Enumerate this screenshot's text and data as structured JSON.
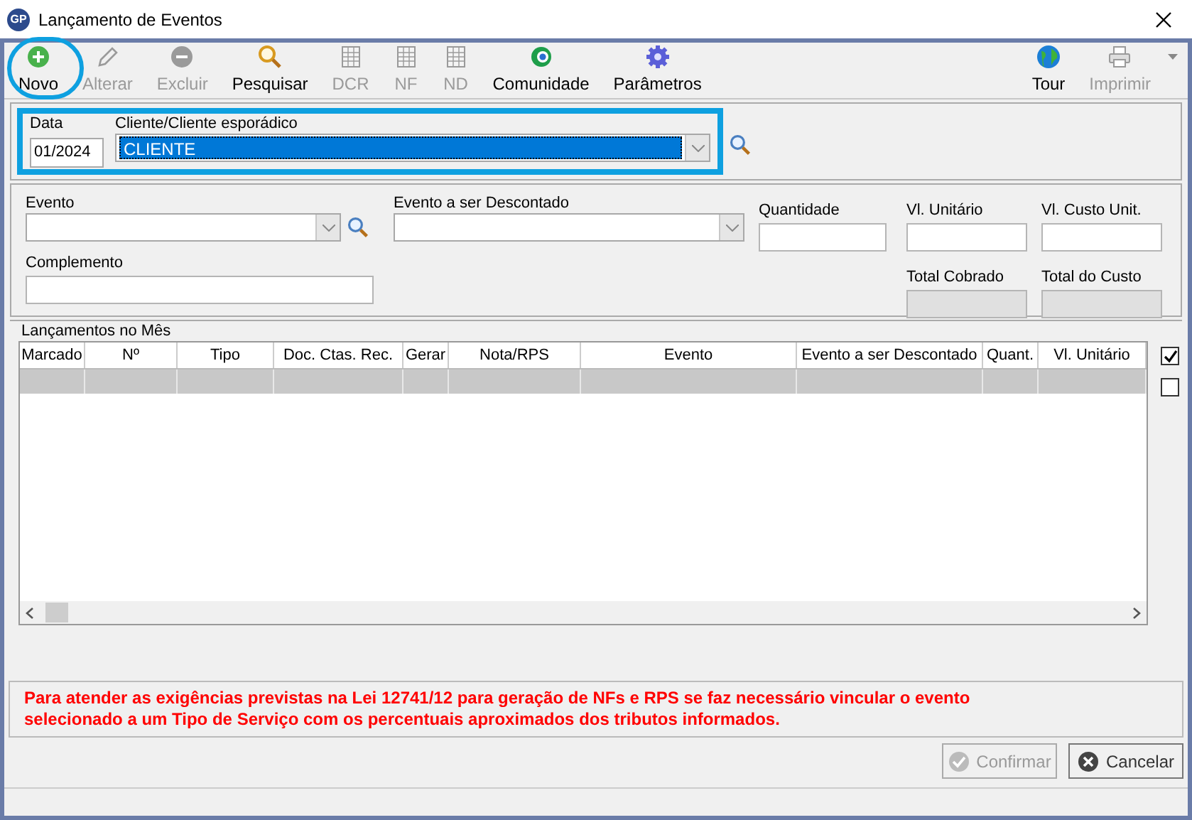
{
  "window": {
    "title": "Lançamento de Eventos",
    "logo": "GP"
  },
  "toolbar": [
    {
      "label": "Novo",
      "kind": "add",
      "disabled": false
    },
    {
      "label": "Alterar",
      "kind": "edit",
      "disabled": true
    },
    {
      "label": "Excluir",
      "kind": "delete",
      "disabled": true
    },
    {
      "label": "Pesquisar",
      "kind": "search",
      "disabled": false
    },
    {
      "label": "DCR",
      "kind": "grid",
      "disabled": true
    },
    {
      "label": "NF",
      "kind": "grid",
      "disabled": true
    },
    {
      "label": "ND",
      "kind": "grid",
      "disabled": true
    },
    {
      "label": "Comunidade",
      "kind": "community",
      "disabled": false
    },
    {
      "label": "Parâmetros",
      "kind": "gear",
      "disabled": false
    }
  ],
  "toolbar_right": [
    {
      "label": "Tour",
      "kind": "globe",
      "disabled": false
    },
    {
      "label": "Imprimir",
      "kind": "printer",
      "disabled": true
    }
  ],
  "header": {
    "date_label": "Data",
    "date_value": "01/2024",
    "client_label": "Cliente/Cliente esporádico",
    "client_value": "CLIENTE"
  },
  "form": {
    "evento_label": "Evento",
    "descontado_label": "Evento a ser Descontado",
    "quantidade_label": "Quantidade",
    "vl_unitario_label": "Vl. Unitário",
    "vl_custo_label": "Vl. Custo Unit.",
    "complemento_label": "Complemento",
    "total_cobrado_label": "Total Cobrado",
    "total_custo_label": "Total do Custo"
  },
  "table": {
    "title": "Lançamentos no Mês",
    "columns": [
      "Marcado",
      "Nº",
      "Tipo",
      "Doc. Ctas. Rec.",
      "Gerar",
      "Nota/RPS",
      "Evento",
      "Evento a ser Descontado",
      "Quant.",
      "Vl. Unitário"
    ]
  },
  "side_checks": [
    {
      "checked": true
    },
    {
      "checked": false
    }
  ],
  "notice": "Para atender as exigências previstas na Lei 12741/12 para geração de NFs e RPS se faz necessário vincular o evento selecionado a um Tipo de Serviço com os percentuais aproximados dos tributos informados.",
  "buttons": [
    {
      "label": "Confirmar",
      "kind": "confirm",
      "disabled": true
    },
    {
      "label": "Cancelar",
      "kind": "cancel",
      "disabled": false
    }
  ]
}
